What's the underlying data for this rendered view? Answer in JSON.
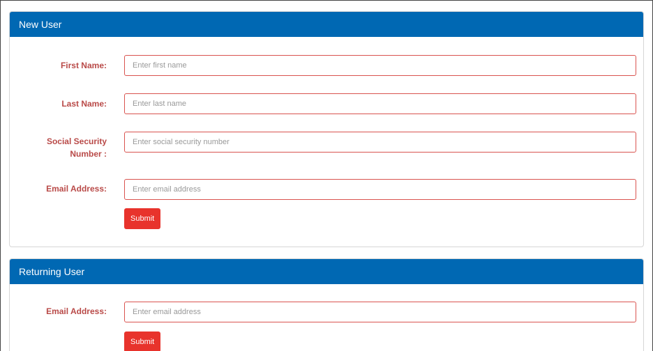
{
  "new_user": {
    "title": "New User",
    "fields": [
      {
        "label": "First Name:",
        "placeholder": "Enter first name",
        "value": ""
      },
      {
        "label": "Last Name:",
        "placeholder": "Enter last name",
        "value": ""
      },
      {
        "label_line1": "Social Security",
        "label_line2": "Number :",
        "placeholder": "Enter social security number",
        "value": ""
      },
      {
        "label": "Email Address:",
        "placeholder": "Enter email address",
        "value": ""
      }
    ],
    "submit_label": "Submit"
  },
  "returning_user": {
    "title": "Returning User",
    "fields": [
      {
        "label": "Email Address:",
        "placeholder": "Enter email address",
        "value": ""
      }
    ],
    "submit_label": "Submit"
  },
  "colors": {
    "header_bg": "#0068b3",
    "label_text": "#b94a48",
    "input_border": "#d9534f",
    "submit_bg": "#e8332c"
  }
}
